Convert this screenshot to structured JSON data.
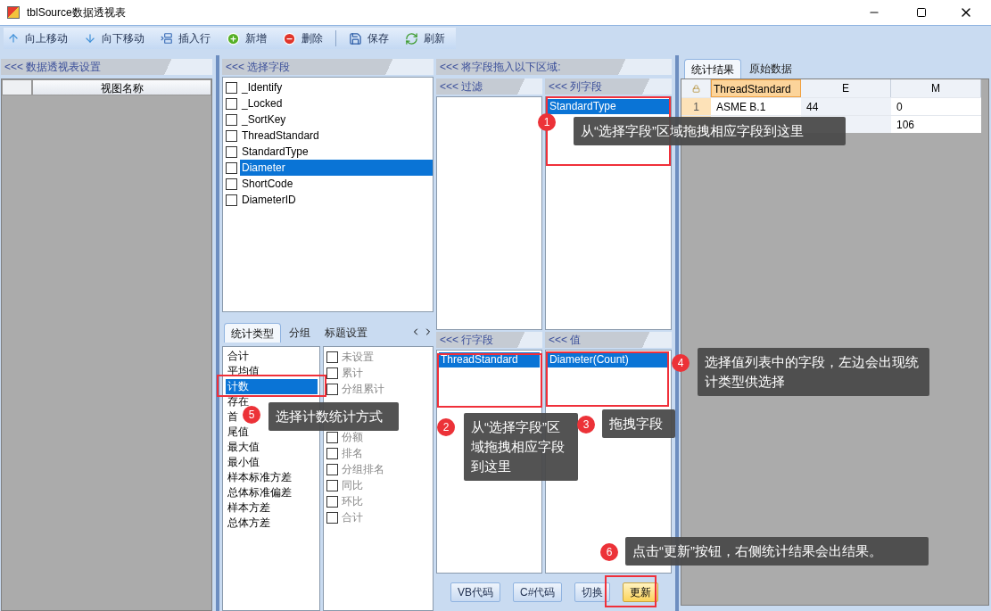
{
  "window": {
    "title": "tblSource数据透视表"
  },
  "toolbar": [
    {
      "kind": "up",
      "label": "向上移动"
    },
    {
      "kind": "down",
      "label": "向下移动"
    },
    {
      "kind": "insert",
      "label": "插入行"
    },
    {
      "kind": "add",
      "label": "新增"
    },
    {
      "kind": "delete",
      "label": "删除"
    },
    {
      "kind": "save",
      "label": "保存"
    },
    {
      "kind": "refresh",
      "label": "刷新"
    }
  ],
  "settings_panel": {
    "title": "<<< 数据透视表设置",
    "column": "视图名称"
  },
  "fields_panel": {
    "title": "<<< 选择字段",
    "fields": [
      {
        "label": "_Identify",
        "checked": false,
        "selected": false
      },
      {
        "label": "_Locked",
        "checked": false,
        "selected": false
      },
      {
        "label": "_SortKey",
        "checked": false,
        "selected": false
      },
      {
        "label": "ThreadStandard",
        "checked": false,
        "selected": false
      },
      {
        "label": "StandardType",
        "checked": false,
        "selected": false
      },
      {
        "label": "Diameter",
        "checked": false,
        "selected": true
      },
      {
        "label": "ShortCode",
        "checked": false,
        "selected": false
      },
      {
        "label": "DiameterID",
        "checked": false,
        "selected": false
      }
    ]
  },
  "stat_tabs": [
    {
      "label": "统计类型",
      "selected": true
    },
    {
      "label": "分组",
      "selected": false
    },
    {
      "label": "标题设置",
      "selected": false
    }
  ],
  "stat_types": [
    {
      "label": "合计",
      "selected": false
    },
    {
      "label": "平均值",
      "selected": false
    },
    {
      "label": "计数",
      "selected": true
    },
    {
      "label": "存在",
      "selected": false
    },
    {
      "label": "首",
      "selected": false
    },
    {
      "label": "尾值",
      "selected": false
    },
    {
      "label": "最大值",
      "selected": false
    },
    {
      "label": "最小值",
      "selected": false
    },
    {
      "label": "样本标准方差",
      "selected": false
    },
    {
      "label": "总体标准偏差",
      "selected": false
    },
    {
      "label": "样本方差",
      "selected": false
    },
    {
      "label": "总体方差",
      "selected": false
    }
  ],
  "stat_options": [
    {
      "kind": "option",
      "label": "未设置",
      "checked": false
    },
    {
      "kind": "option",
      "label": "累计",
      "checked": false
    },
    {
      "kind": "option",
      "label": "分组累计",
      "checked": false
    },
    {
      "kind": "covered"
    },
    {
      "kind": "covered"
    },
    {
      "kind": "option",
      "label": "份额",
      "checked": false
    },
    {
      "kind": "option",
      "label": "排名",
      "checked": false
    },
    {
      "kind": "option",
      "label": "分组排名",
      "checked": false
    },
    {
      "kind": "option",
      "label": "同比",
      "checked": false
    },
    {
      "kind": "option",
      "label": "环比",
      "checked": false
    },
    {
      "kind": "option",
      "label": "合计",
      "checked": false
    }
  ],
  "drop_panel": {
    "title": "<<< 将字段拖入以下区域:",
    "filter": {
      "title": "<<< 过滤"
    },
    "columns": {
      "title": "<<< 列字段",
      "items": [
        {
          "label": "StandardType",
          "selected": true
        }
      ]
    },
    "rows": {
      "title": "<<< 行字段",
      "items": [
        {
          "label": "ThreadStandard",
          "selected": true
        }
      ]
    },
    "values": {
      "title": "<<< 值",
      "items": [
        {
          "label": "Diameter(Count)",
          "selected": true
        }
      ]
    }
  },
  "buttons": [
    {
      "label": "VB代码",
      "selected": false
    },
    {
      "label": "C#代码",
      "selected": false
    },
    {
      "label": "切换",
      "selected": false
    },
    {
      "label": "更新",
      "selected": true
    }
  ],
  "result_tabs": [
    {
      "label": "统计结果",
      "selected": true
    },
    {
      "label": "原始数据",
      "selected": false
    }
  ],
  "result_table": {
    "columns": [
      "ThreadStandard",
      "E",
      "M"
    ],
    "rows": [
      {
        "number": "1",
        "cells": [
          "ASME B.1",
          "44",
          "0"
        ]
      },
      {
        "cells": [
          null,
          null,
          "106"
        ]
      }
    ]
  },
  "callouts": [
    {
      "number": "1",
      "text": "从“选择字段”区域拖拽相应字段到这里"
    },
    {
      "number": "2",
      "text": "从“选择字段”区域拖拽相应字段到这里"
    },
    {
      "number": "3",
      "text": "拖拽字段"
    },
    {
      "number": "4",
      "text": "选择值列表中的字段，左边会出现统计类型供选择"
    },
    {
      "number": "5",
      "text": "选择计数统计方式"
    },
    {
      "number": "6",
      "text": "点击“更新”按钮，右侧统计结果会出结果。"
    }
  ]
}
